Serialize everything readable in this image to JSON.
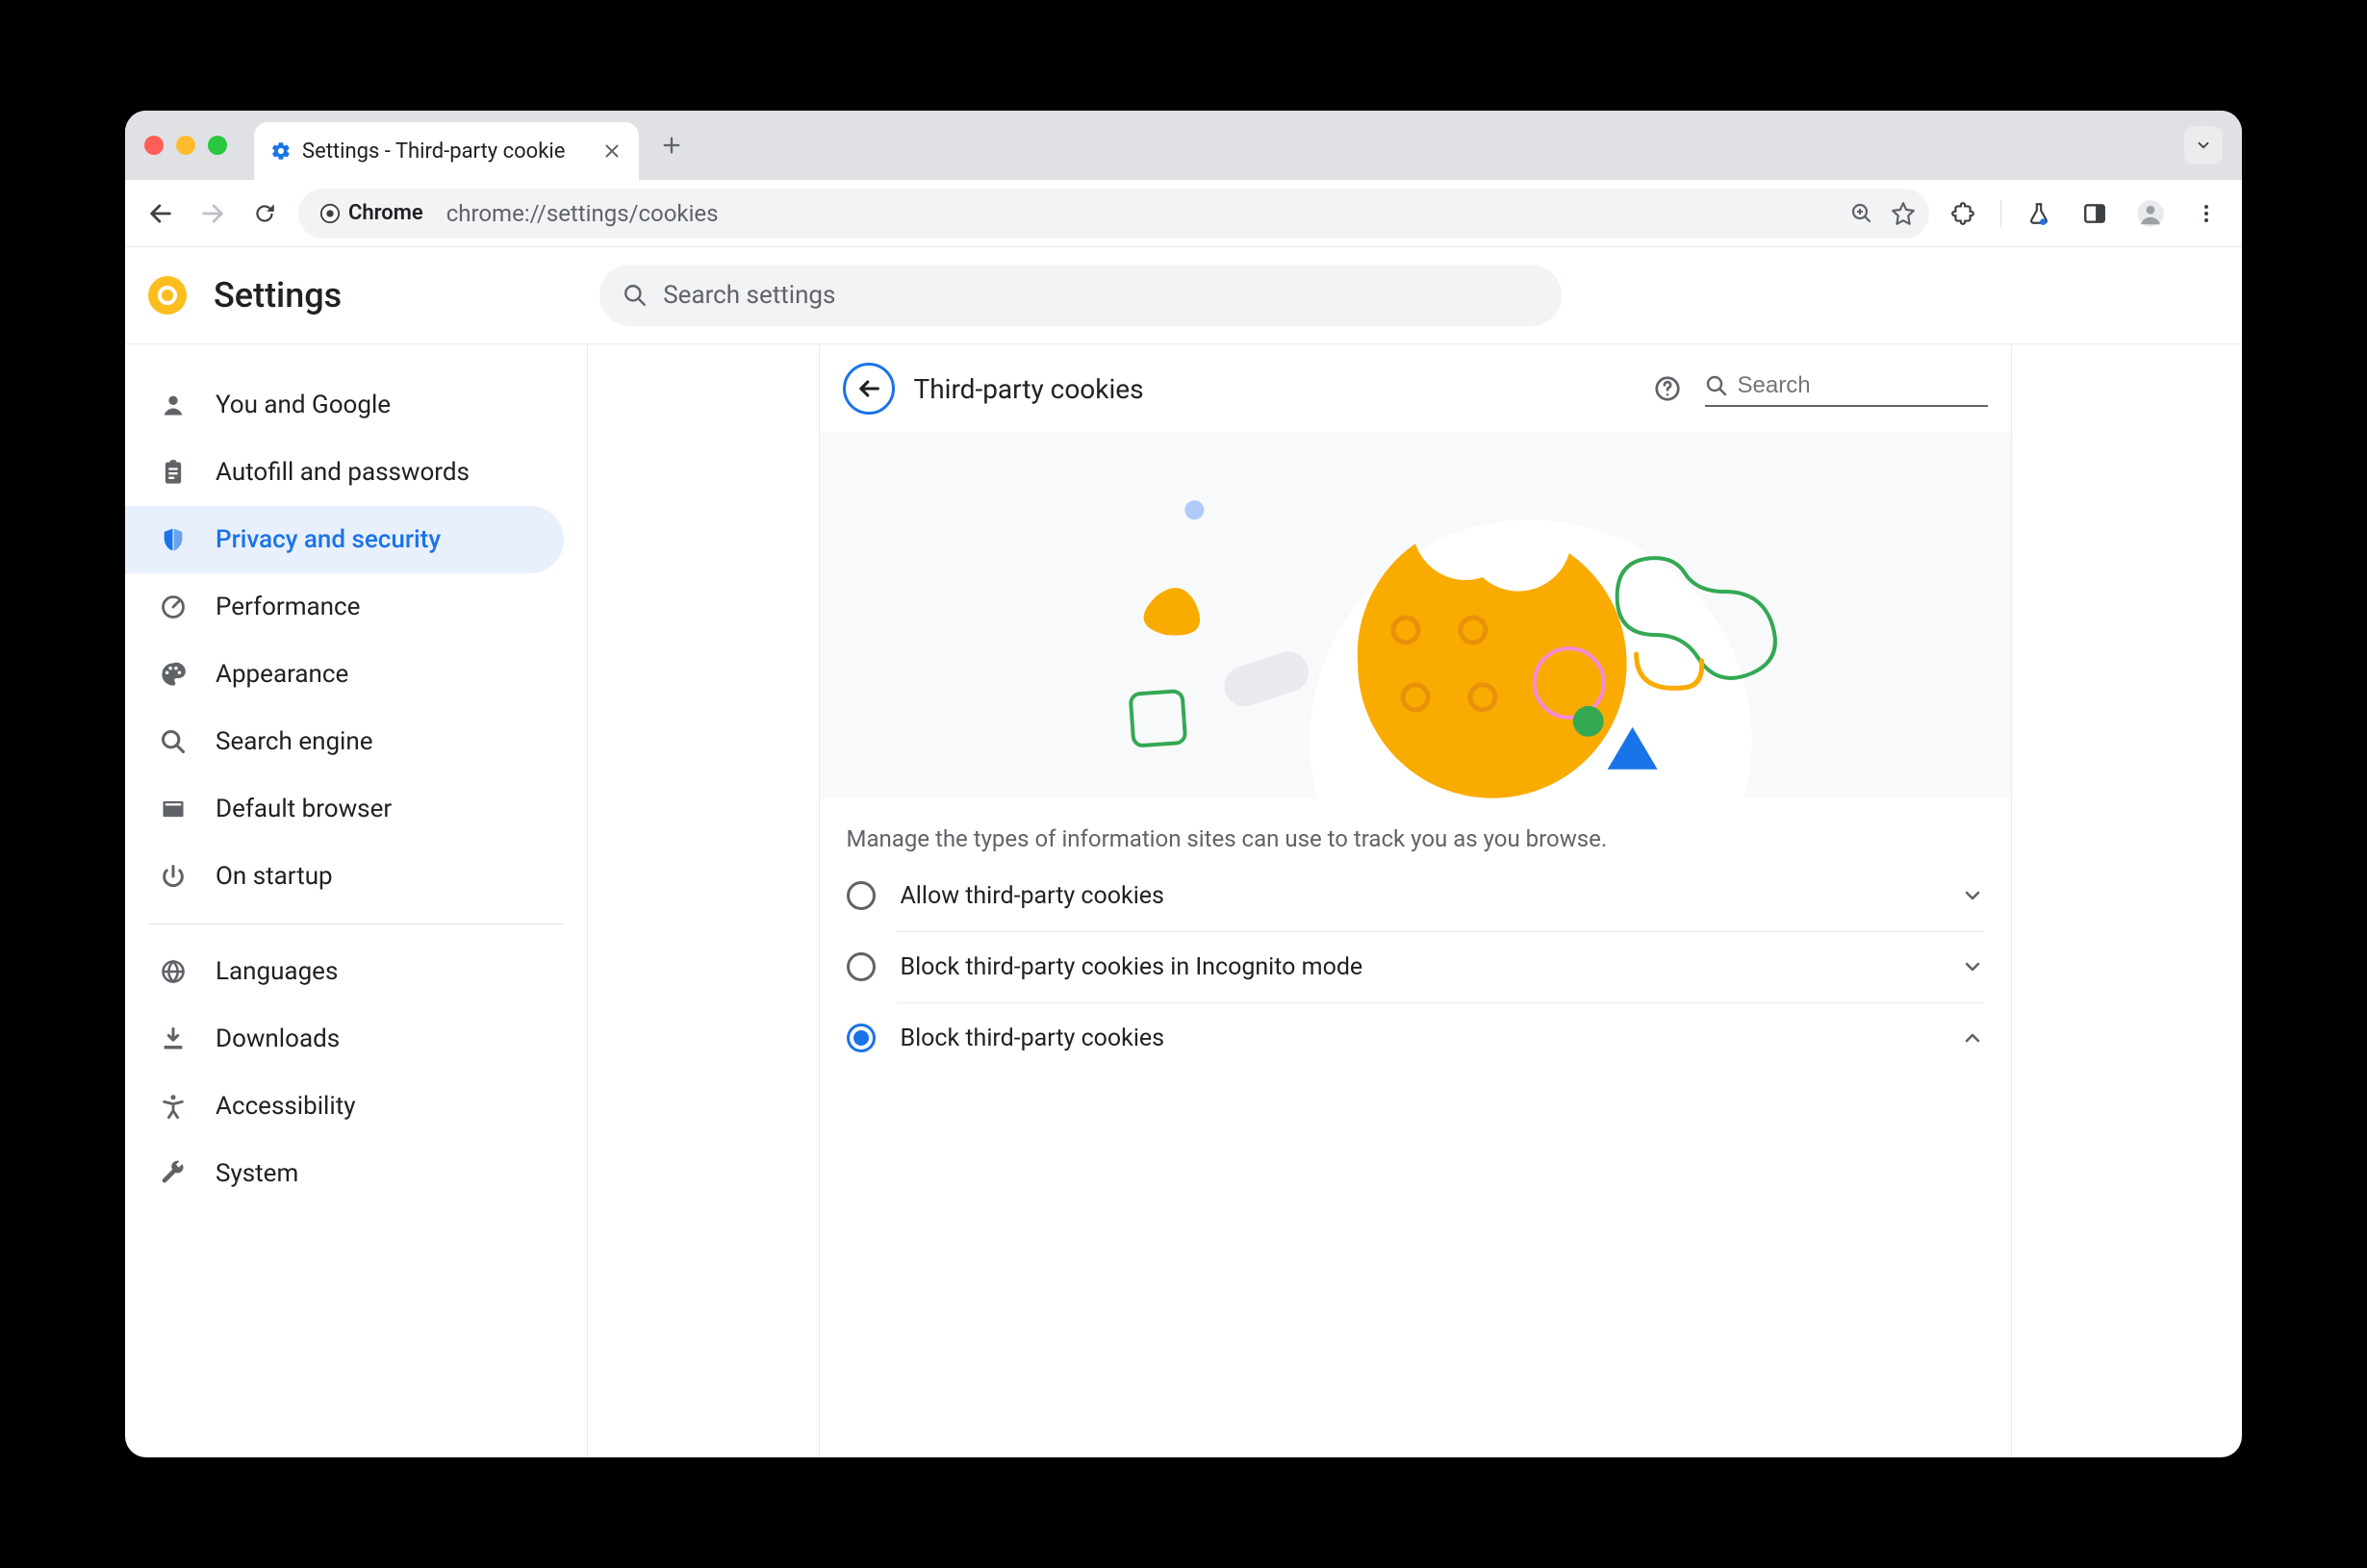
{
  "browser": {
    "tab_title": "Settings - Third-party cookie",
    "url_label": "Chrome",
    "url": "chrome://settings/cookies"
  },
  "app": {
    "name": "Settings",
    "search_placeholder": "Search settings"
  },
  "sidebar": {
    "items": [
      {
        "icon": "person",
        "label": "You and Google"
      },
      {
        "icon": "clipboard",
        "label": "Autofill and passwords"
      },
      {
        "icon": "shield",
        "label": "Privacy and security",
        "active": true
      },
      {
        "icon": "gauge",
        "label": "Performance"
      },
      {
        "icon": "palette",
        "label": "Appearance"
      },
      {
        "icon": "search",
        "label": "Search engine"
      },
      {
        "icon": "window",
        "label": "Default browser"
      },
      {
        "icon": "power",
        "label": "On startup"
      }
    ],
    "items2": [
      {
        "icon": "globe",
        "label": "Languages"
      },
      {
        "icon": "download",
        "label": "Downloads"
      },
      {
        "icon": "accessibility",
        "label": "Accessibility"
      },
      {
        "icon": "wrench",
        "label": "System"
      }
    ]
  },
  "panel": {
    "title": "Third-party cookies",
    "search_placeholder": "Search",
    "desc": "Manage the types of information sites can use to track you as you browse.",
    "options": [
      {
        "label": "Allow third-party cookies",
        "selected": false,
        "expanded": false
      },
      {
        "label": "Block third-party cookies in Incognito mode",
        "selected": false,
        "expanded": false
      },
      {
        "label": "Block third-party cookies",
        "selected": true,
        "expanded": true
      }
    ]
  }
}
